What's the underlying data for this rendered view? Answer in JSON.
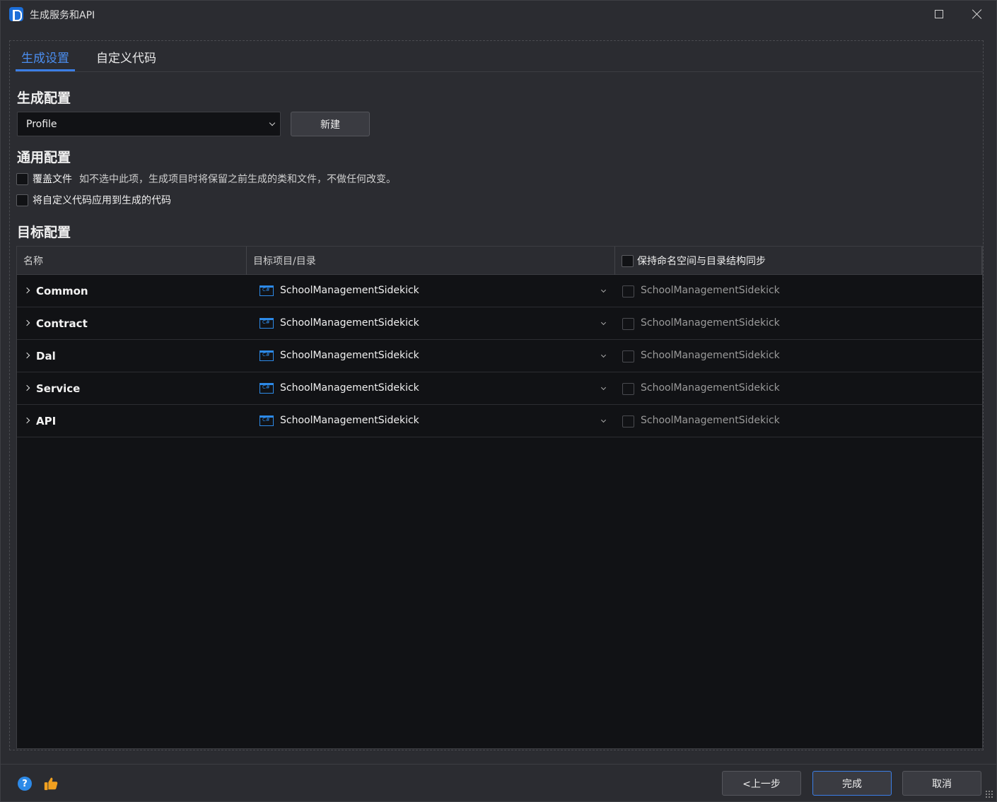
{
  "window": {
    "title": "生成服务和API",
    "icons": {
      "app": "app-logo-icon",
      "maximize": "maximize-icon",
      "close": "close-icon"
    }
  },
  "tabs": [
    {
      "label": "生成设置",
      "active": true
    },
    {
      "label": "自定义代码",
      "active": false
    }
  ],
  "generation_config": {
    "title": "生成配置",
    "profile_value": "Profile",
    "new_button": "新建"
  },
  "general_config": {
    "title": "通用配置",
    "overwrite": {
      "label": "覆盖文件",
      "hint": "如不选中此项，生成项目时将保留之前生成的类和文件，不做任何改变。",
      "checked": false
    },
    "apply_custom": {
      "label": "将自定义代码应用到生成的代码",
      "checked": false
    }
  },
  "target_config": {
    "title": "目标配置",
    "columns": {
      "name": "名称",
      "target": "目标项目/目录",
      "sync": "保持命名空间与目录结构同步"
    },
    "rows": [
      {
        "name": "Common",
        "project": "SchoolManagementSidekick",
        "namespace": "SchoolManagementSidekick"
      },
      {
        "name": "Contract",
        "project": "SchoolManagementSidekick",
        "namespace": "SchoolManagementSidekick"
      },
      {
        "name": "Dal",
        "project": "SchoolManagementSidekick",
        "namespace": "SchoolManagementSidekick"
      },
      {
        "name": "Service",
        "project": "SchoolManagementSidekick",
        "namespace": "SchoolManagementSidekick"
      },
      {
        "name": "API",
        "project": "SchoolManagementSidekick",
        "namespace": "SchoolManagementSidekick"
      }
    ]
  },
  "footer": {
    "prev_button": "<上一步",
    "finish_button": "完成",
    "cancel_button": "取消",
    "help_glyph": "?"
  },
  "colors": {
    "accent": "#3b7ee6",
    "background": "#2b2c31",
    "grid_bg": "#111215",
    "csharp": "#2d8ae8",
    "thumb": "#f0a020"
  }
}
